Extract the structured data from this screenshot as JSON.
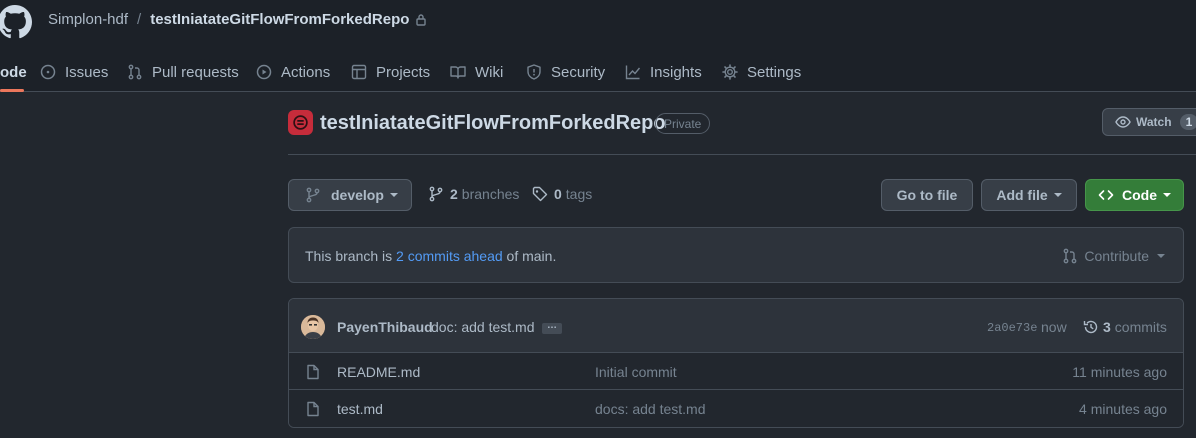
{
  "header": {
    "owner": "Simplon-hdf",
    "separator": "/",
    "repo": "testIniatateGitFlowFromForkedRepo"
  },
  "nav": {
    "code": "ode",
    "issues": "Issues",
    "pull_requests": "Pull requests",
    "actions": "Actions",
    "projects": "Projects",
    "wiki": "Wiki",
    "security": "Security",
    "insights": "Insights",
    "settings": "Settings"
  },
  "repo": {
    "title": "testIniatateGitFlowFromForkedRepo",
    "visibility": "Private",
    "watch_label": "Watch",
    "watch_count": "1"
  },
  "toolbar": {
    "branch": "develop",
    "branches_count": "2",
    "branches_label": "branches",
    "tags_count": "0",
    "tags_label": "tags",
    "go_to_file": "Go to file",
    "add_file": "Add file",
    "code": "Code"
  },
  "ahead": {
    "prefix": "This branch is",
    "link": "2 commits ahead",
    "suffix": "of main.",
    "contribute": "Contribute"
  },
  "latest_commit": {
    "author": "PayenThibaud",
    "message": "doc: add test.md",
    "ellipsis": "…",
    "sha": "2a0e73e",
    "time": "now",
    "count": "3",
    "count_label": "commits"
  },
  "files": [
    {
      "name": "README.md",
      "commit": "Initial commit",
      "age": "11 minutes ago"
    },
    {
      "name": "test.md",
      "commit": "docs: add test.md",
      "age": "4 minutes ago"
    }
  ],
  "colors": {
    "background": "#22272e",
    "header": "#1c2128",
    "accent_link": "#539bf5",
    "code_button": "#347d39",
    "active_tab": "#ec775c"
  }
}
